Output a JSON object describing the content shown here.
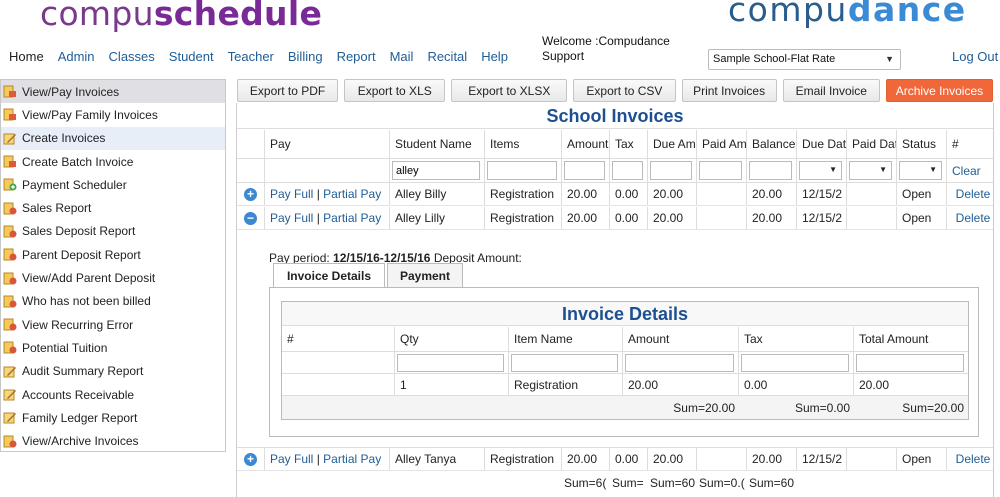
{
  "branding": {
    "left_logo_light": "compu",
    "left_logo_bold": "schedule",
    "right_logo_light": "compu",
    "right_logo_bold": "dance"
  },
  "nav": [
    "Home",
    "Admin",
    "Classes",
    "Student",
    "Teacher",
    "Billing",
    "Report",
    "Mail",
    "Recital",
    "Help"
  ],
  "welcome": "Welcome :Compudance Support",
  "school_select": "Sample School-Flat Rate",
  "logout": "Log Out",
  "sidebar": [
    {
      "label": "View/Pay Invoices",
      "icon": "invoice-icon"
    },
    {
      "label": "View/Pay Family Invoices",
      "icon": "invoice-icon"
    },
    {
      "label": "Create Invoices",
      "icon": "edit-icon"
    },
    {
      "label": "Create Batch Invoice",
      "icon": "invoice-icon"
    },
    {
      "label": "Payment Scheduler",
      "icon": "add-icon"
    },
    {
      "label": "Sales Report",
      "icon": "report-icon"
    },
    {
      "label": "Sales Deposit Report",
      "icon": "report-icon"
    },
    {
      "label": "Parent Deposit Report",
      "icon": "report-icon"
    },
    {
      "label": "View/Add Parent Deposit",
      "icon": "report-icon"
    },
    {
      "label": "Who has not been billed",
      "icon": "report-icon"
    },
    {
      "label": "View Recurring Error",
      "icon": "report-icon"
    },
    {
      "label": "Potential Tuition",
      "icon": "report-icon"
    },
    {
      "label": "Audit Summary Report",
      "icon": "edit-icon"
    },
    {
      "label": "Accounts Receivable",
      "icon": "edit-icon"
    },
    {
      "label": "Family Ledger Report",
      "icon": "edit-icon"
    },
    {
      "label": "View/Archive Invoices",
      "icon": "report-icon"
    }
  ],
  "toolbar": [
    "Export to PDF",
    "Export to XLS",
    "Export to XLSX",
    "Export to CSV",
    "Print Invoices",
    "Email Invoice",
    "Archive Invoices"
  ],
  "grid": {
    "title": "School Invoices",
    "headers": [
      "Pay",
      "Student Name",
      "Items",
      "Amount",
      "Tax",
      "Due Am",
      "Paid Am",
      "Balance",
      "Due Dat",
      "Paid Dat",
      "Status",
      "#"
    ],
    "filter_student": "alley",
    "clear": "Clear",
    "pay_full": "Pay Full",
    "sep": "|",
    "partial_pay": "Partial Pay",
    "delete": "Delete",
    "rows": [
      {
        "expand": "+",
        "student": "Alley Billy",
        "items": "Registration",
        "amount": "20.00",
        "tax": "0.00",
        "due": "20.00",
        "paid": "",
        "balance": "20.00",
        "due_date": "12/15/2",
        "paid_date": "",
        "status": "Open"
      },
      {
        "expand": "−",
        "student": "Alley Lilly",
        "items": "Registration",
        "amount": "20.00",
        "tax": "0.00",
        "due": "20.00",
        "paid": "",
        "balance": "20.00",
        "due_date": "12/15/2",
        "paid_date": "",
        "status": "Open"
      },
      {
        "expand": "+",
        "student": "Alley Tanya",
        "items": "Registration",
        "amount": "20.00",
        "tax": "0.00",
        "due": "20.00",
        "paid": "",
        "balance": "20.00",
        "due_date": "12/15/2",
        "paid_date": "",
        "status": "Open"
      }
    ],
    "sums": {
      "amount": "Sum=6(",
      "tax": "Sum=",
      "due": "Sum=60",
      "paid": "Sum=0.(",
      "balance": "Sum=60"
    }
  },
  "detail": {
    "pay_period_label": "Pay period:",
    "pay_period_value": "12/15/16-12/15/16",
    "deposit_label": "Deposit Amount:",
    "tab_invoice": "Invoice Details",
    "tab_payment": "Payment",
    "inner_title": "Invoice Details",
    "headers": [
      "#",
      "Qty",
      "Item Name",
      "Amount",
      "Tax",
      "Total Amount"
    ],
    "row": {
      "num": "",
      "qty": "1",
      "item": "Registration",
      "amount": "20.00",
      "tax": "0.00",
      "total": "20.00"
    },
    "sums": {
      "amount": "Sum=20.00",
      "tax": "Sum=0.00",
      "total": "Sum=20.00"
    }
  }
}
